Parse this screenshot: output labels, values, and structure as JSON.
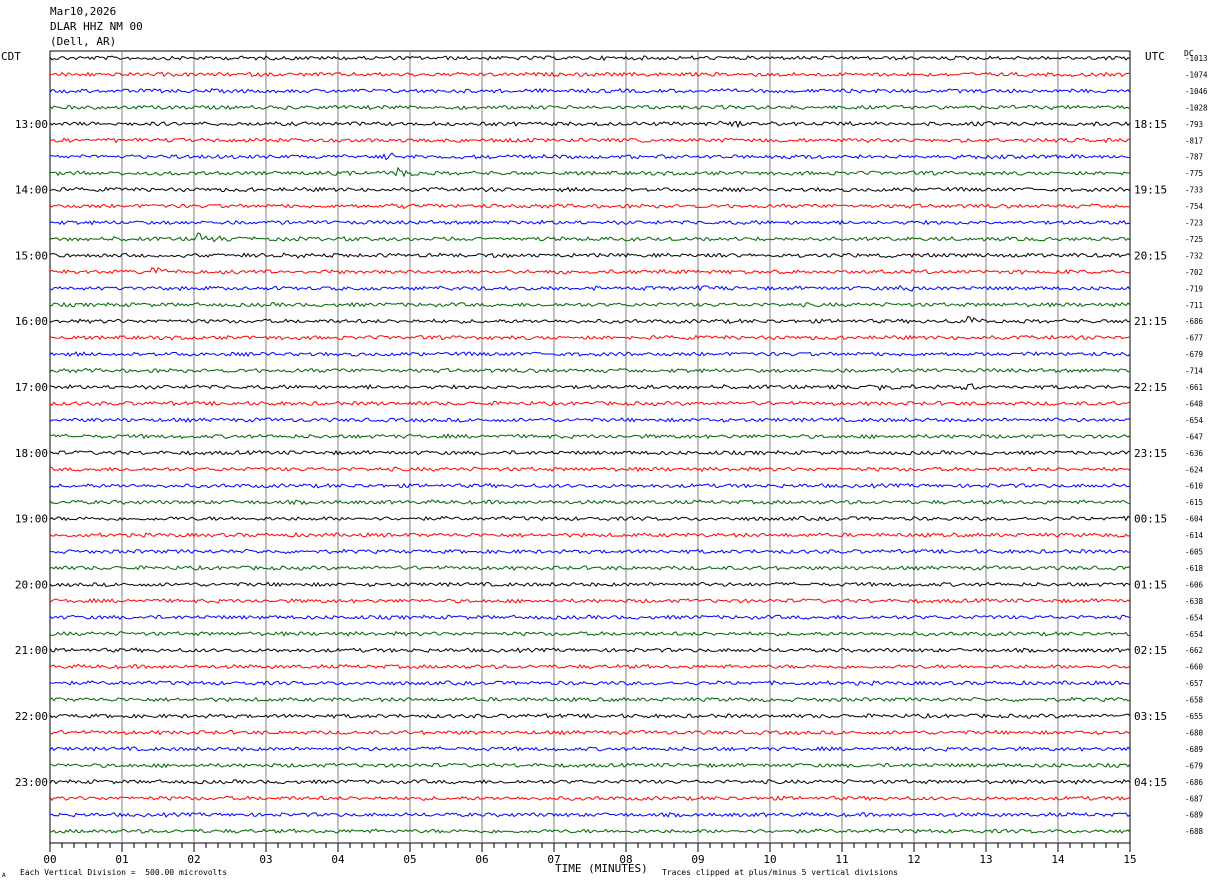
{
  "header": {
    "date": "Mar10,2026",
    "station": "DLAR HHZ NM 00",
    "location": "(Dell, AR)"
  },
  "left_axis_label": "CDT",
  "right_axis_label": "UTC",
  "dc_label": "DC",
  "footer": {
    "xlabel": "TIME (MINUTES)",
    "division_note": "Each Vertical Division =  500.00 microvolts",
    "clip_note": "Traces clipped at plus/minus 5 vertical divisions",
    "corner_mark": "A"
  },
  "colors": {
    "trace_cycle": [
      "#000000",
      "#ff0000",
      "#0000ff",
      "#006400"
    ],
    "grid": "#808080"
  },
  "chart_data": {
    "type": "line",
    "description_kind": "helicorder",
    "xlabel": "TIME (MINUTES)",
    "xlim": [
      0,
      15
    ],
    "x_ticks": [
      "00",
      "01",
      "02",
      "03",
      "04",
      "05",
      "06",
      "07",
      "08",
      "09",
      "10",
      "11",
      "12",
      "13",
      "14",
      "15"
    ],
    "left_hour_labels": [
      "13:00",
      "14:00",
      "15:00",
      "16:00",
      "17:00",
      "18:00",
      "19:00",
      "20:00",
      "21:00",
      "22:00",
      "23:00"
    ],
    "right_hour_labels": [
      "18:15",
      "19:15",
      "20:15",
      "21:15",
      "22:15",
      "23:15",
      "00:15",
      "01:15",
      "02:15",
      "03:15",
      "04:15"
    ],
    "dc_offsets": [
      -1013,
      -1074,
      -1046,
      -1028,
      -793,
      -817,
      -787,
      -775,
      -733,
      -754,
      -723,
      -725,
      -732,
      -702,
      -719,
      -711,
      -686,
      -677,
      -679,
      -714,
      -661,
      -648,
      -654,
      -647,
      -636,
      -624,
      -610,
      -615,
      -604,
      -614,
      -605,
      -618,
      -606,
      -638,
      -654,
      -654,
      -662,
      -660,
      -657,
      -658,
      -655,
      -680,
      -689,
      -679,
      -686,
      -687,
      -689,
      -688
    ],
    "events": [
      {
        "trace": 4,
        "minute": 9.3,
        "amp": 2.4
      },
      {
        "trace": 6,
        "minute": 4.6,
        "amp": 1.6
      },
      {
        "trace": 7,
        "minute": 4.8,
        "amp": 2.6
      },
      {
        "trace": 9,
        "minute": 4.8,
        "amp": 1.0
      },
      {
        "trace": 11,
        "minute": 2.05,
        "amp": 2.2
      },
      {
        "trace": 12,
        "minute": 3.3,
        "amp": 1.0
      },
      {
        "trace": 13,
        "minute": 1.4,
        "amp": 2.0
      },
      {
        "trace": 14,
        "minute": 9.0,
        "amp": 1.0
      },
      {
        "trace": 14,
        "minute": 11.85,
        "amp": 1.4
      },
      {
        "trace": 16,
        "minute": 12.75,
        "amp": 2.2
      },
      {
        "trace": 20,
        "minute": 11.5,
        "amp": 1.0
      },
      {
        "trace": 20,
        "minute": 12.7,
        "amp": 1.0
      }
    ]
  }
}
